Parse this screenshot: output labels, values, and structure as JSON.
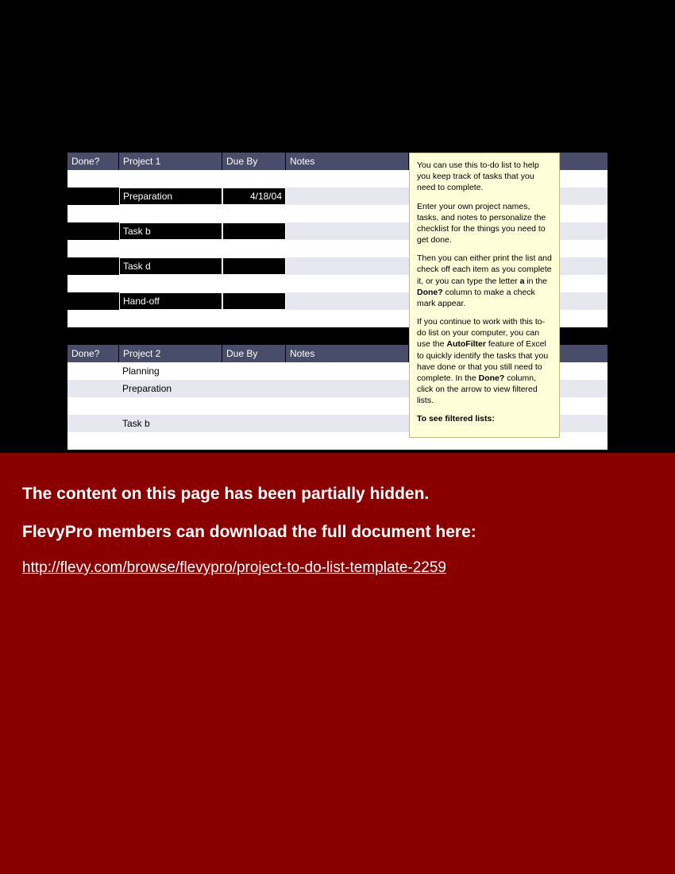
{
  "project1": {
    "headers": {
      "done": "Done?",
      "task": "Project 1",
      "due": "Due By",
      "notes": "Notes"
    },
    "rows": [
      {
        "task": "Preparation",
        "due": "4/18/04",
        "sel": true
      },
      {
        "task": "Task b",
        "due": "",
        "sel": true
      },
      {
        "task": "Task d",
        "due": "",
        "sel": true
      },
      {
        "task": "Hand-off",
        "due": "",
        "sel": true
      }
    ]
  },
  "project2": {
    "headers": {
      "done": "Done?",
      "task": "Project 2",
      "due": "Due By",
      "notes": "Notes"
    },
    "rows": [
      {
        "task": "Planning",
        "due": ""
      },
      {
        "task": "Preparation",
        "due": ""
      },
      {
        "task": "Task b",
        "due": ""
      }
    ]
  },
  "note": {
    "p1a": "You can use this to-do list to help you keep track of tasks that you need to complete.",
    "p2a": "Enter your own project names, tasks, and notes to personalize the checklist for the things you need to get done.",
    "p3a": "Then you can either print the list and check off each item as you complete it, or you can type the letter ",
    "p3b": "a",
    "p3c": " in the ",
    "p3d": "Done?",
    "p3e": " column to make a check mark appear.",
    "p4a": "If you continue to work with this to-do list on your computer, you can use the ",
    "p4b": "AutoFilter",
    "p4c": " feature of Excel to quickly identify the tasks that you have done or that you still need to complete. In the ",
    "p4d": "Done?",
    "p4e": " column, click on the arrow to view filtered lists.",
    "p5a": "To see filtered lists:"
  },
  "overlay": {
    "line1": "The content on this page has been partially hidden.",
    "line2": "FlevyPro members can download the full document here:",
    "link": "http://flevy.com/browse/flevypro/project-to-do-list-template-2259"
  }
}
